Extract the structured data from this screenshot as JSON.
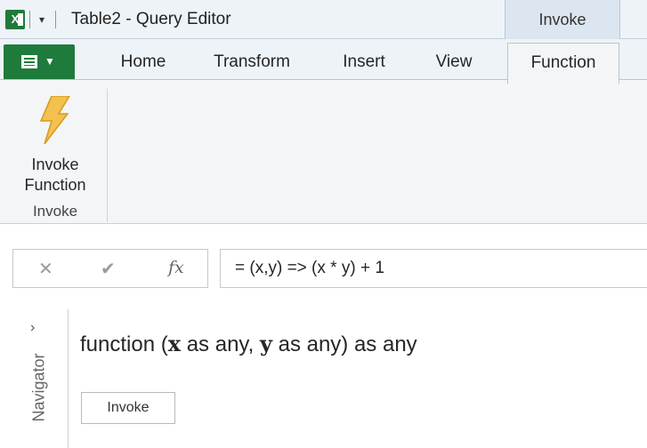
{
  "window": {
    "title": "Table2 - Query Editor",
    "contextual_tab_group": "Invoke",
    "qat_dropdown_icon": "▾"
  },
  "ribbon": {
    "tabs": [
      {
        "label": "Home"
      },
      {
        "label": "Transform"
      },
      {
        "label": "Insert"
      },
      {
        "label": "View"
      },
      {
        "label": "Function",
        "active": true
      }
    ],
    "groups": [
      {
        "label": "Invoke",
        "buttons": [
          {
            "label_line1": "Invoke",
            "label_line2": "Function",
            "icon": "lightning-bolt-icon"
          }
        ]
      }
    ]
  },
  "formula_bar": {
    "cancel_icon": "✕",
    "confirm_icon": "✔",
    "fx_icon": "fx",
    "formula": "= (x,y) => (x * y) + 1"
  },
  "navigator": {
    "label": "Navigator",
    "chevron": "›"
  },
  "content": {
    "signature_prefix": "function (",
    "param1": "x",
    "param1_type": " as any, ",
    "param2": "y",
    "signature_suffix": " as any) as any",
    "invoke_button": "Invoke"
  },
  "colors": {
    "excel_green": "#1e7b3c",
    "bolt_yellow": "#f2c14e",
    "ribbon_bg": "#f3f5f7"
  }
}
